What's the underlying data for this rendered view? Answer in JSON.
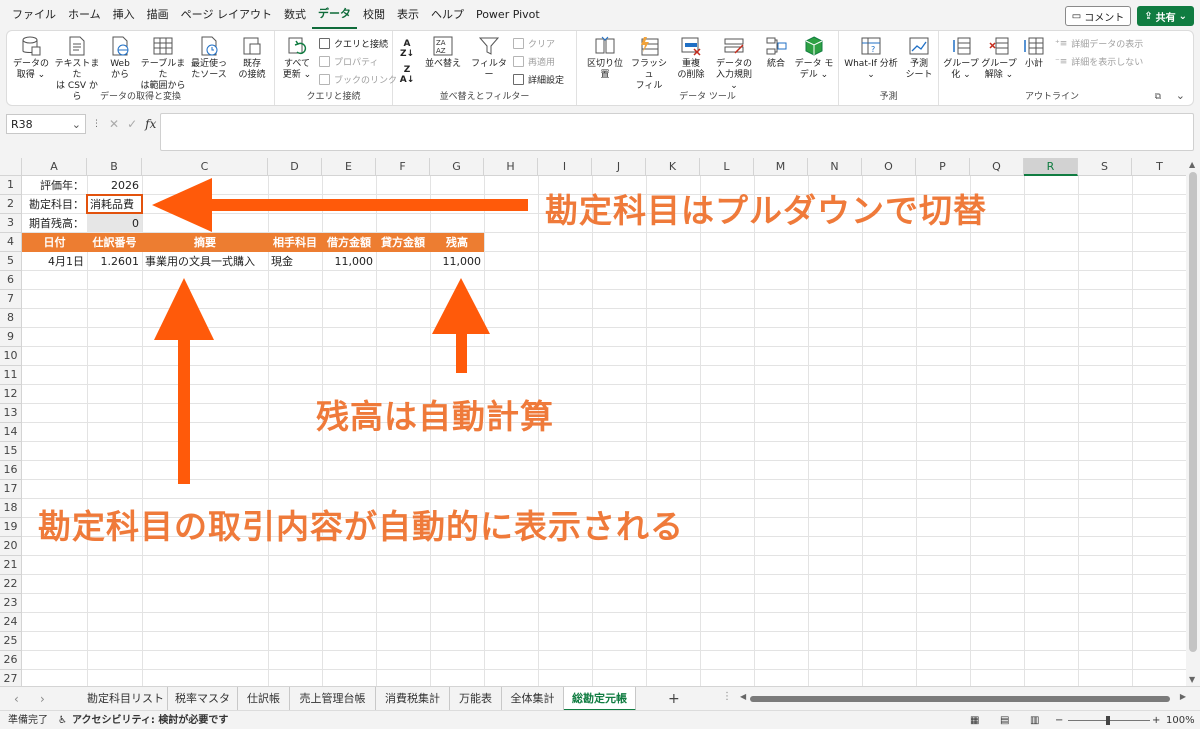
{
  "menu": {
    "tabs": [
      "ファイル",
      "ホーム",
      "挿入",
      "描画",
      "ページ レイアウト",
      "数式",
      "データ",
      "校閲",
      "表示",
      "ヘルプ",
      "Power Pivot"
    ],
    "active": "データ",
    "comment_label": "コメント",
    "share_label": "共有"
  },
  "ribbon": {
    "group1": {
      "label": "データの取得と変換",
      "buttons": [
        {
          "line1": "データの",
          "line2": "取得 ⌄"
        },
        {
          "line1": "テキストまた",
          "line2": "は CSV から"
        },
        {
          "line1": "Web",
          "line2": "から"
        },
        {
          "line1": "テーブルまた",
          "line2": "は範囲から"
        },
        {
          "line1": "最近使っ",
          "line2": "たソース"
        },
        {
          "line1": "既存",
          "line2": "の接続"
        }
      ]
    },
    "group2": {
      "label": "クエリと接続",
      "refresh": {
        "line1": "すべて",
        "line2": "更新 ⌄"
      },
      "small": [
        "クエリと接続",
        "プロパティ",
        "ブックのリンク"
      ]
    },
    "group3": {
      "label": "並べ替えとフィルター",
      "sort_label": "並べ替え",
      "filter_label": "フィルター",
      "small": [
        "クリア",
        "再適用",
        "詳細設定"
      ]
    },
    "group4": {
      "label": "データ ツール",
      "buttons": [
        {
          "line1": "区切り位置",
          "line2": ""
        },
        {
          "line1": "フラッシュ",
          "line2": "フィル"
        },
        {
          "line1": "重複",
          "line2": "の削除"
        },
        {
          "line1": "データの",
          "line2": "入力規則 ⌄"
        },
        {
          "line1": "統合",
          "line2": ""
        },
        {
          "line1": "データ モ",
          "line2": "デル ⌄"
        }
      ]
    },
    "group5": {
      "label": "予測",
      "buttons": [
        {
          "line1": "What-If 分析",
          "line2": "⌄"
        },
        {
          "line1": "予測",
          "line2": "シート"
        }
      ]
    },
    "group6": {
      "label": "アウトライン",
      "buttons": [
        {
          "line1": "グループ",
          "line2": "化 ⌄"
        },
        {
          "line1": "グループ",
          "line2": "解除 ⌄"
        },
        {
          "line1": "小計",
          "line2": ""
        }
      ],
      "small": [
        "詳細データの表示",
        "詳細を表示しない"
      ]
    }
  },
  "formula_bar": {
    "name_box": "R38",
    "fx": "fx",
    "content": ""
  },
  "grid": {
    "columns": [
      "A",
      "B",
      "C",
      "D",
      "E",
      "F",
      "G",
      "H",
      "I",
      "J",
      "K",
      "L",
      "M",
      "N",
      "O",
      "P",
      "Q",
      "R",
      "S",
      "T"
    ],
    "selected_column": "R",
    "rows": [
      "1",
      "2",
      "3",
      "4",
      "5",
      "6",
      "7",
      "8",
      "9",
      "10",
      "11",
      "12",
      "13",
      "14",
      "15",
      "16",
      "17",
      "18",
      "19",
      "20",
      "21",
      "22",
      "23",
      "24",
      "25",
      "26",
      "27"
    ],
    "cells": {
      "a1": "評価年：",
      "b1": "2026",
      "a2": "勘定科目：",
      "b2": "消耗品費",
      "a3": "期首残高：",
      "b3": "0",
      "header": [
        "日付",
        "仕訳番号",
        "摘要",
        "相手科目",
        "借方金額",
        "貸方金額",
        "残高"
      ],
      "row5": [
        "4月1日",
        "1.2601",
        "事業用の文具一式購入",
        "現金",
        "11,000",
        "",
        "11,000"
      ]
    }
  },
  "annotations": {
    "top": "勘定科目はプルダウンで切替",
    "middle": "残高は自動計算",
    "bottom": "勘定科目の取引内容が自動的に表示される",
    "color": "#ef7a3a",
    "arrow_color": "#ff5a0a"
  },
  "sheet_tabs": {
    "tabs": [
      "勘定科目リスト",
      "税率マスタ",
      "仕訳帳",
      "売上管理台帳",
      "消費税集計",
      "万能表",
      "全体集計",
      "総勘定元帳"
    ],
    "active": "総勘定元帳",
    "add": "+"
  },
  "status": {
    "ready": "準備完了",
    "accessibility": "アクセシビリティ: 検討が必要です",
    "zoom": "100%"
  }
}
